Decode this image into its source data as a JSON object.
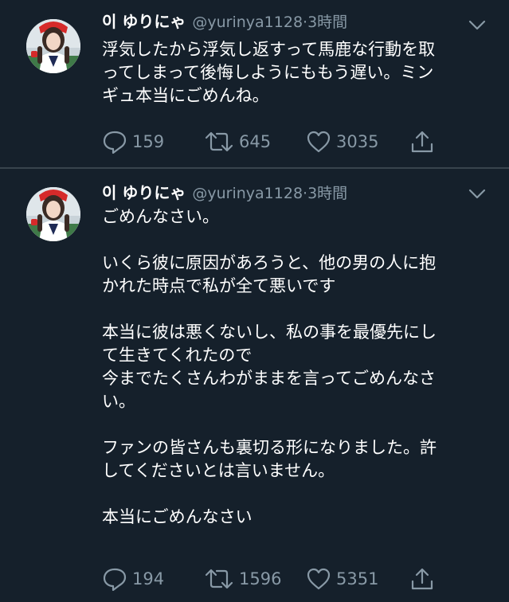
{
  "tweets": [
    {
      "name": "이 ゆりにゃ",
      "handle": "@yurinya1128",
      "separator": "·",
      "time": "3時間",
      "lines": [
        "浮気したから浮気し返すって馬鹿な行動を取",
        "ってしまって後悔しようにももう遅い。ミン",
        "ギュ本当にごめんね。"
      ],
      "replies": "159",
      "retweets": "645",
      "likes": "3035"
    },
    {
      "name": "이 ゆりにゃ",
      "handle": "@yurinya1128",
      "separator": "·",
      "time": "3時間",
      "lines": [
        "ごめんなさい。",
        "",
        "いくら彼に原因があろうと、他の男の人に抱",
        "かれた時点で私が全て悪いです",
        "",
        "本当に彼は悪くないし、私の事を最優先にし",
        "て生きてくれたので",
        "今までたくさんわがままを言ってごめんなさ",
        "い。",
        "",
        "ファンの皆さんも裏切る形になりました。許",
        "してくださいとは言いません。",
        "",
        "本当にごめんなさい"
      ],
      "replies": "194",
      "retweets": "1596",
      "likes": "5351"
    }
  ],
  "icons": {
    "reply": "reply-icon",
    "retweet": "retweet-icon",
    "like": "heart-icon",
    "share": "share-icon",
    "more": "chevron-down-icon"
  },
  "colors": {
    "background": "#15202b",
    "divider": "#38444d",
    "secondary_text": "#8899a6",
    "primary_text": "#ffffff"
  }
}
